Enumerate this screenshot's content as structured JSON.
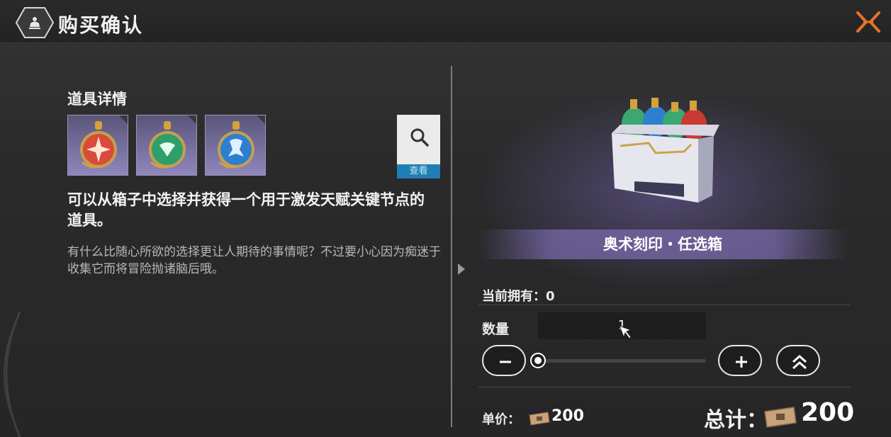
{
  "header": {
    "title": "购买确认"
  },
  "detail": {
    "section_title": "道具详情",
    "items": [
      {
        "icon": "red-seal-icon",
        "color": "#d94a3a"
      },
      {
        "icon": "green-seal-icon",
        "color": "#2f9e6a"
      },
      {
        "icon": "blue-seal-icon",
        "color": "#2f7fd0"
      }
    ],
    "view_label": "查看",
    "description": "可以从箱子中选择并获得一个用于激发天赋关键节点的道具。",
    "flavor": "有什么比随心所欲的选择更让人期待的事情呢？不过要小心因为痴迷于收集它而将冒险抛诸脑后哦。"
  },
  "purchase": {
    "item_name": "奥术刻印・任选箱",
    "owned_label": "当前拥有：",
    "owned_value": "0",
    "quantity_label": "数量",
    "quantity_value": "1",
    "quantity_fraction": 0,
    "unit_price_label": "单价：",
    "unit_price_value": "200",
    "total_label": "总计：",
    "total_value": "200"
  },
  "colors": {
    "accent_close": "#e8722a",
    "view_button_bar": "#1f7fb4",
    "band_purple": "#786aa9"
  }
}
